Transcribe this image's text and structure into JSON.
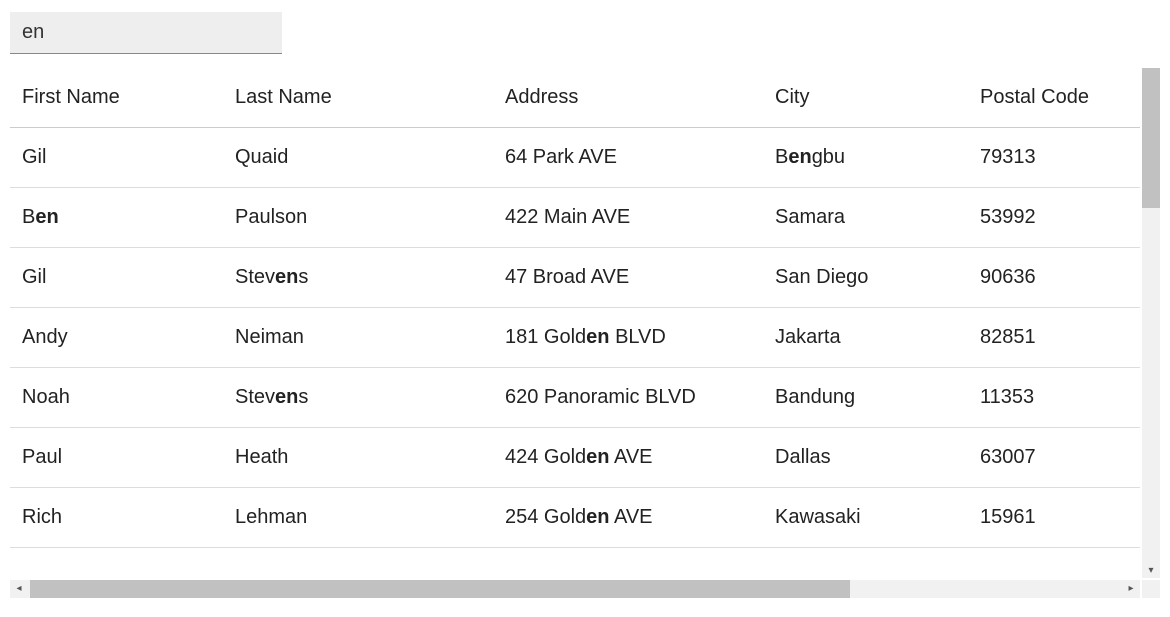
{
  "search": {
    "value": "en",
    "placeholder": ""
  },
  "highlight_term": "en",
  "columns": [
    {
      "key": "first_name",
      "label": "First Name"
    },
    {
      "key": "last_name",
      "label": "Last Name"
    },
    {
      "key": "address",
      "label": "Address"
    },
    {
      "key": "city",
      "label": "City"
    },
    {
      "key": "postal",
      "label": "Postal Code"
    }
  ],
  "rows": [
    {
      "first_name": "Gil",
      "last_name": "Quaid",
      "address": "64 Park AVE",
      "city": "Bengbu",
      "postal": "79313"
    },
    {
      "first_name": "Ben",
      "last_name": "Paulson",
      "address": "422 Main AVE",
      "city": "Samara",
      "postal": "53992"
    },
    {
      "first_name": "Gil",
      "last_name": "Stevens",
      "address": "47 Broad AVE",
      "city": "San Diego",
      "postal": "90636"
    },
    {
      "first_name": "Andy",
      "last_name": "Neiman",
      "address": "181 Golden BLVD",
      "city": "Jakarta",
      "postal": "82851"
    },
    {
      "first_name": "Noah",
      "last_name": "Stevens",
      "address": "620 Panoramic BLVD",
      "city": "Bandung",
      "postal": "11353"
    },
    {
      "first_name": "Paul",
      "last_name": "Heath",
      "address": "424 Golden AVE",
      "city": "Dallas",
      "postal": "63007"
    },
    {
      "first_name": "Rich",
      "last_name": "Lehman",
      "address": "254 Golden AVE",
      "city": "Kawasaki",
      "postal": "15961"
    }
  ],
  "scroll": {
    "arrow_up": "▴",
    "arrow_down": "▾",
    "arrow_left": "◂",
    "arrow_right": "▸"
  }
}
